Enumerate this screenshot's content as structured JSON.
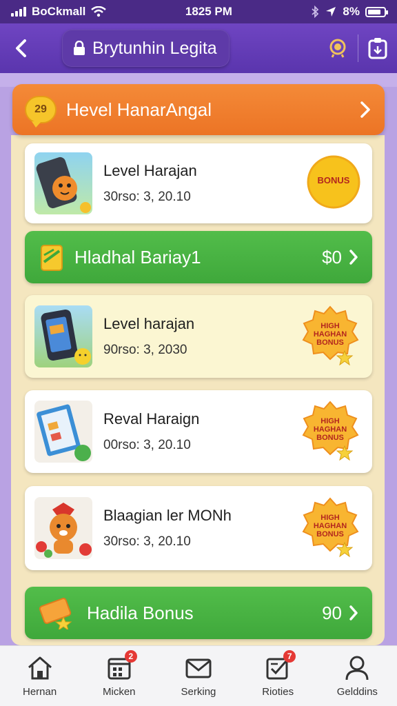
{
  "status_bar": {
    "carrier": "BoCkmall",
    "time": "1825 PM",
    "battery": "8%",
    "battery_level": 0.8
  },
  "header": {
    "title": "Brytunhin Legita"
  },
  "banner": {
    "badge": "29",
    "title": "Hevel HanarAngal"
  },
  "cards": [
    {
      "title": "Level Harajan",
      "date": "30rso: 3, 20.10",
      "badge": "BONUS"
    },
    {
      "title": "Level harajan",
      "date": "90rso: 3, 2030",
      "badge": "HIGH HAGHAN BONUS"
    },
    {
      "title": "Reval Haraign",
      "date": "00rso: 3, 20.10",
      "badge": "HIGH HAGHAN BONUS"
    },
    {
      "title": "Blaagian ler MONh",
      "date": "30rso: 3, 20.10",
      "badge": "HIGH HAGHAN BONUS"
    }
  ],
  "green_bars": [
    {
      "title": "Hladhal Bariay1",
      "value": "$0"
    },
    {
      "title": "Hadila Bonus",
      "value": "90"
    }
  ],
  "nav": [
    {
      "label": "Hernan",
      "icon": "home-icon"
    },
    {
      "label": "Micken",
      "icon": "calendar-icon",
      "badge": "2"
    },
    {
      "label": "Serking",
      "icon": "mail-icon"
    },
    {
      "label": "Rioties",
      "icon": "checklist-icon",
      "badge": "7"
    },
    {
      "label": "Gelddins",
      "icon": "profile-icon"
    }
  ],
  "colors": {
    "header": "#5a35ad",
    "banner": "#ec7425",
    "green": "#3fa83b",
    "panel": "#f4e6bf"
  }
}
